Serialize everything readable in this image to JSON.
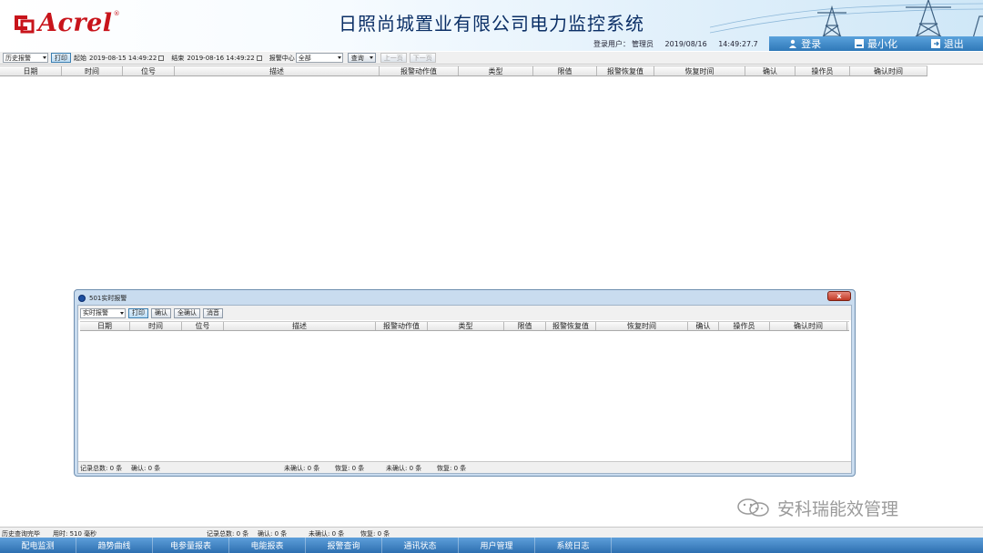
{
  "header": {
    "logo_text": "Acrel",
    "logo_reg": "®",
    "title": "日照尚城置业有限公司电力监控系统",
    "login_label": "登录用户：",
    "login_user": "管理员",
    "date": "2019/08/16",
    "time": "14:49:27.7",
    "buttons": {
      "login": "登录",
      "minimize": "最小化",
      "exit": "退出"
    }
  },
  "toolbar": {
    "mode": "历史报警",
    "print": "打印",
    "start_label": "起始",
    "start_value": "2019-08-15 14:49:22",
    "end_label": "结束",
    "end_value": "2019-08-16 14:49:22",
    "center_label": "报警中心",
    "center_value": "全部",
    "query": "查询",
    "prev": "上一页",
    "next": "下一页"
  },
  "main_table": {
    "columns": [
      "日期",
      "时间",
      "位号",
      "描述",
      "报警动作值",
      "类型",
      "限值",
      "报警恢复值",
      "恢复时间",
      "确认",
      "操作员",
      "确认时间"
    ]
  },
  "dialog": {
    "title": "501实时报警",
    "close": "x",
    "mode": "实时报警",
    "buttons": {
      "print": "打印",
      "confirm": "确认",
      "confirm_all": "全确认",
      "silence": "消音"
    },
    "columns": [
      "日期",
      "时间",
      "位号",
      "描述",
      "报警动作值",
      "类型",
      "限值",
      "报警恢复值",
      "恢复时间",
      "确认",
      "操作员",
      "确认时间"
    ],
    "status": {
      "total": "记录总数: 0 条",
      "confirmed": "确认: 0 条",
      "unconfirmed": "未确认: 0 条",
      "recovered": "恢复: 0 条",
      "unconfirmed2": "未确认: 0 条",
      "recovered2": "恢复: 0 条"
    }
  },
  "statusbar": {
    "query_done": "历史查询完毕",
    "elapsed": "用时: 510 毫秒",
    "total": "记录总数: 0 条",
    "confirmed": "确认: 0 条",
    "unconfirmed": "未确认: 0 条",
    "recovered": "恢复: 0 条"
  },
  "watermark": "安科瑞能效管理",
  "bottom_nav": [
    "配电监测",
    "趋势曲线",
    "电参量报表",
    "电能报表",
    "报警查询",
    "通讯状态",
    "用户管理",
    "系统日志"
  ],
  "colors": {
    "nav_blue": "#2d6fb0",
    "title_navy": "#0b2f66",
    "logo_red": "#c8141b"
  }
}
